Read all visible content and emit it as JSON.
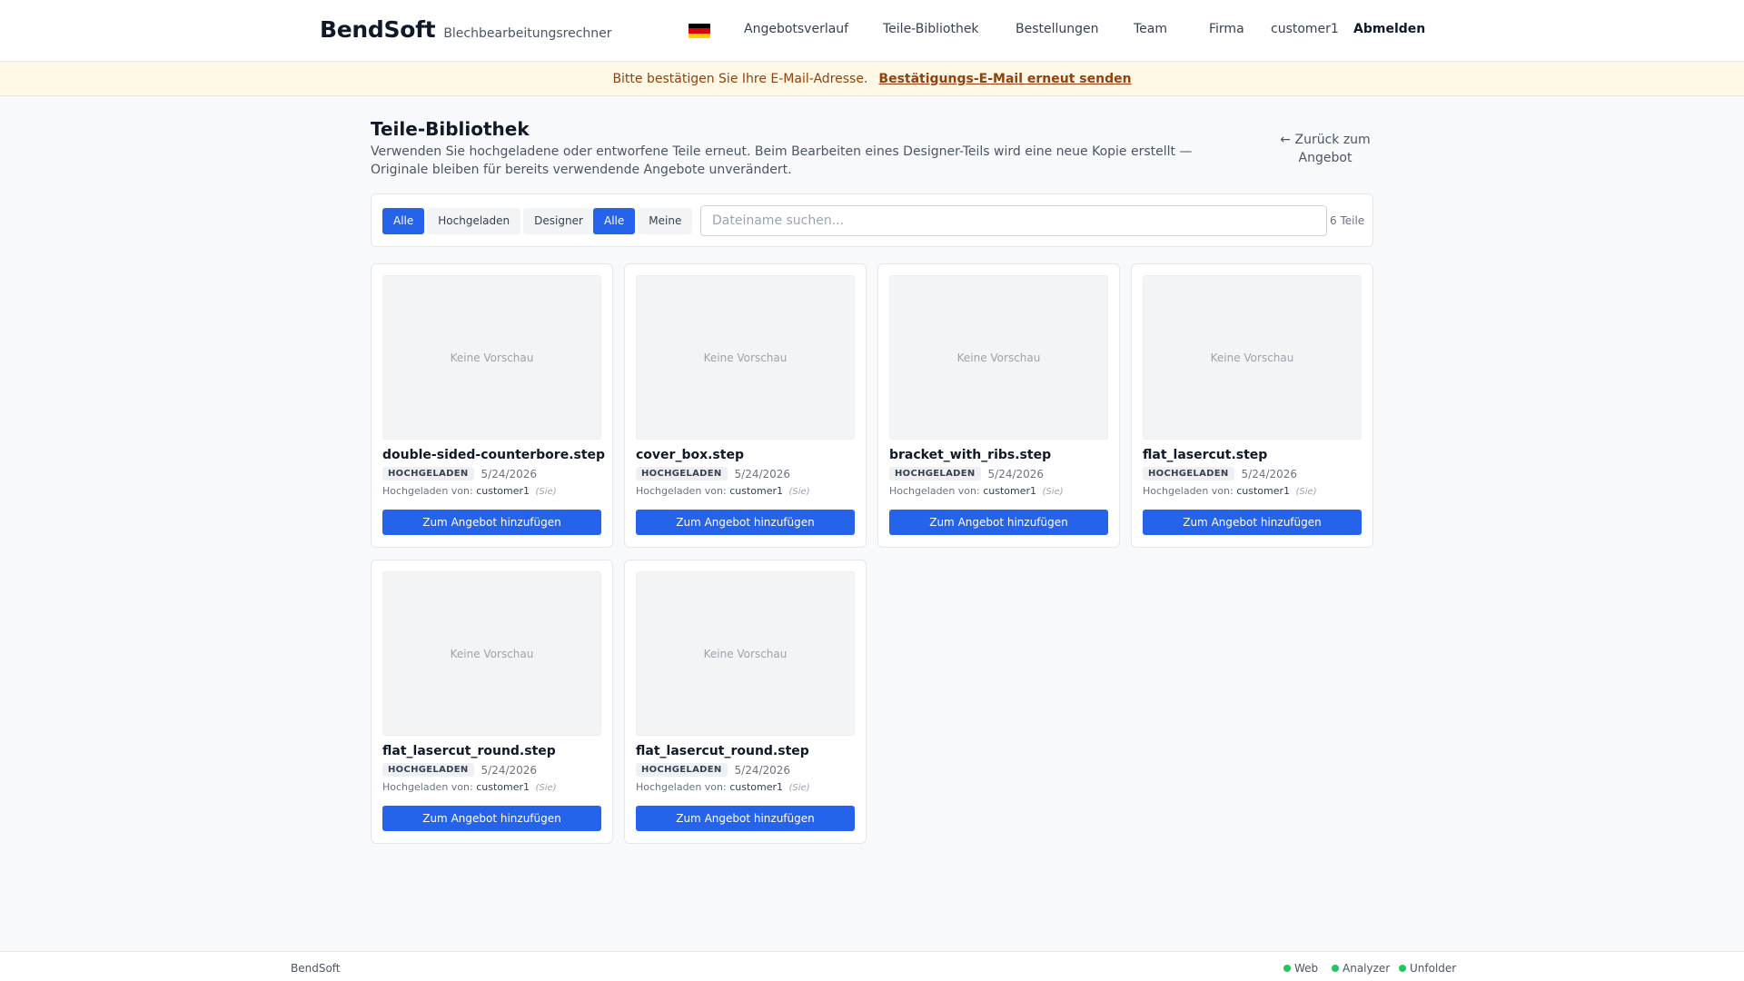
{
  "header": {
    "brand": "BendSoft",
    "tagline": "Blechbearbeitungsrechner",
    "nav": {
      "quote_history": "Angebotsverlauf",
      "parts_library": "Teile-Bibliothek",
      "orders": "Bestellungen",
      "team": "Team",
      "company": "Firma",
      "user": "customer1",
      "logout": "Abmelden"
    },
    "language_flag": "de-flag-icon"
  },
  "banner": {
    "text": "Bitte bestätigen Sie Ihre E-Mail-Adresse.",
    "link": "Bestätigungs-E-Mail erneut senden"
  },
  "page": {
    "title": "Teile-Bibliothek",
    "description": "Verwenden Sie hochgeladene oder entworfene Teile erneut. Beim Bearbeiten eines Designer-Teils wird eine neue Kopie erstellt — Originale bleiben für bereits verwendende Angebote unverändert.",
    "back_link": "← Zurück zum Angebot"
  },
  "filters": {
    "type": [
      "Alle",
      "Hochgeladen",
      "Designer"
    ],
    "type_active": "Alle",
    "owner": [
      "Alle",
      "Meine"
    ],
    "owner_active": "Alle",
    "search_placeholder": "Dateiname suchen...",
    "search_value": "",
    "count": "6 Teile"
  },
  "parts": [
    {
      "name": "double-sided-counterbore.step",
      "badge": "HOCHGELADEN",
      "date": "5/24/2026",
      "uploaded_by_label": "Hochgeladen von:",
      "user": "customer1",
      "you": "(Sie)",
      "preview": "Keine Vorschau",
      "button": "Zum Angebot hinzufügen"
    },
    {
      "name": "cover_box.step",
      "badge": "HOCHGELADEN",
      "date": "5/24/2026",
      "uploaded_by_label": "Hochgeladen von:",
      "user": "customer1",
      "you": "(Sie)",
      "preview": "Keine Vorschau",
      "button": "Zum Angebot hinzufügen"
    },
    {
      "name": "bracket_with_ribs.step",
      "badge": "HOCHGELADEN",
      "date": "5/24/2026",
      "uploaded_by_label": "Hochgeladen von:",
      "user": "customer1",
      "you": "(Sie)",
      "preview": "Keine Vorschau",
      "button": "Zum Angebot hinzufügen"
    },
    {
      "name": "flat_lasercut.step",
      "badge": "HOCHGELADEN",
      "date": "5/24/2026",
      "uploaded_by_label": "Hochgeladen von:",
      "user": "customer1",
      "you": "(Sie)",
      "preview": "Keine Vorschau",
      "button": "Zum Angebot hinzufügen"
    },
    {
      "name": "flat_lasercut_round.step",
      "badge": "HOCHGELADEN",
      "date": "5/24/2026",
      "uploaded_by_label": "Hochgeladen von:",
      "user": "customer1",
      "you": "(Sie)",
      "preview": "Keine Vorschau",
      "button": "Zum Angebot hinzufügen"
    },
    {
      "name": "flat_lasercut_round.step",
      "badge": "HOCHGELADEN",
      "date": "5/24/2026",
      "uploaded_by_label": "Hochgeladen von:",
      "user": "customer1",
      "you": "(Sie)",
      "preview": "Keine Vorschau",
      "button": "Zum Angebot hinzufügen"
    }
  ],
  "footer": {
    "brand": "BendSoft",
    "services": [
      "Web",
      "Analyzer",
      "Unfolder"
    ],
    "status_color": "#22c55e"
  },
  "colors": {
    "accent": "#2563eb",
    "banner_bg": "#fef9e7",
    "banner_text": "#92400e"
  }
}
